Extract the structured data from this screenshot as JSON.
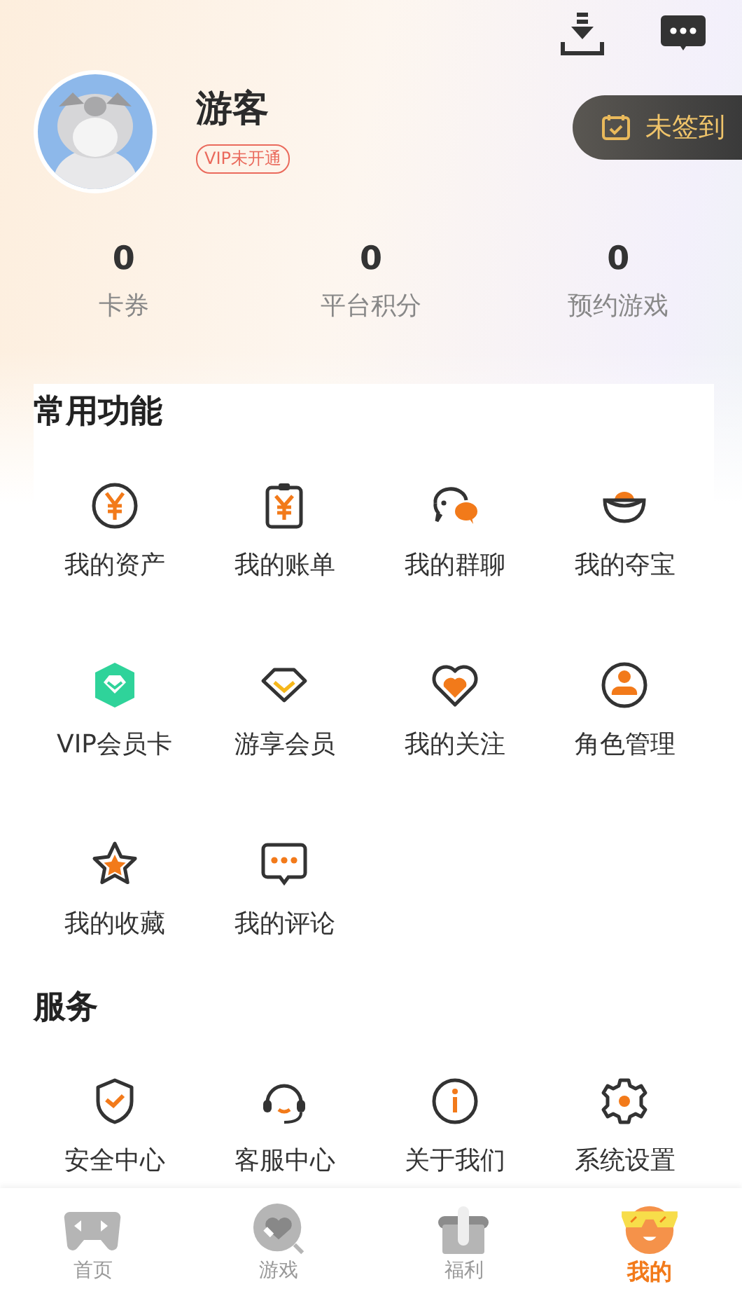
{
  "profile": {
    "name": "游客",
    "vip_badge": "VIP未开通"
  },
  "checkin_button": "未签到",
  "stats": [
    {
      "value": "0",
      "label": "卡券"
    },
    {
      "value": "0",
      "label": "平台积分"
    },
    {
      "value": "0",
      "label": "预约游戏"
    }
  ],
  "sections": [
    {
      "title": "常用功能",
      "items": [
        {
          "label": "我的资产",
          "kind": "coin"
        },
        {
          "label": "我的账单",
          "kind": "bill"
        },
        {
          "label": "我的群聊",
          "kind": "chat"
        },
        {
          "label": "我的夺宝",
          "kind": "ingot"
        },
        {
          "label": "VIP会员卡",
          "kind": "gem"
        },
        {
          "label": "游享会员",
          "kind": "diamond"
        },
        {
          "label": "我的关注",
          "kind": "heart"
        },
        {
          "label": "角色管理",
          "kind": "user"
        },
        {
          "label": "我的收藏",
          "kind": "star"
        },
        {
          "label": "我的评论",
          "kind": "comment"
        }
      ]
    },
    {
      "title": "服务",
      "items": [
        {
          "label": "安全中心",
          "kind": "shield"
        },
        {
          "label": "客服中心",
          "kind": "headset"
        },
        {
          "label": "关于我们",
          "kind": "info"
        },
        {
          "label": "系统设置",
          "kind": "gear"
        }
      ]
    }
  ],
  "tabs": [
    {
      "label": "首页",
      "kind": "gamepad",
      "selected": false
    },
    {
      "label": "游戏",
      "kind": "search",
      "selected": false
    },
    {
      "label": "福利",
      "kind": "gift",
      "selected": false
    },
    {
      "label": "我的",
      "kind": "face",
      "selected": true
    }
  ]
}
